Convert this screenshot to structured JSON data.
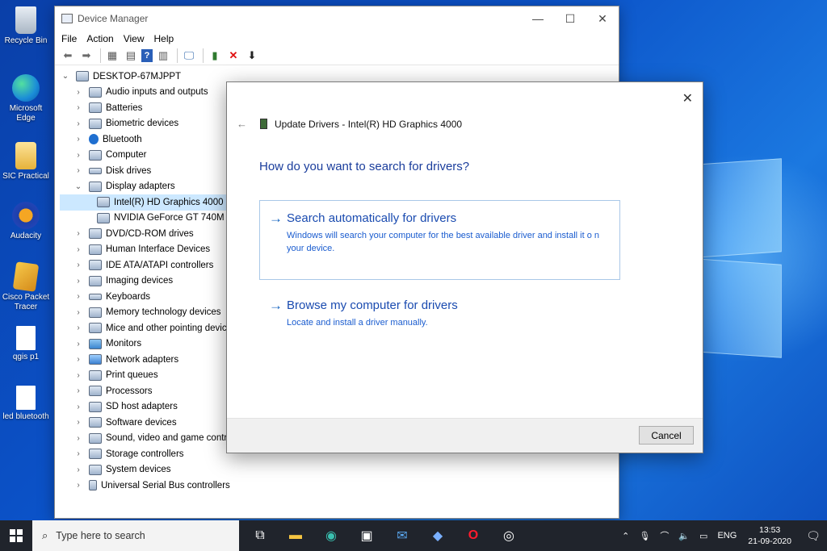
{
  "desktop": {
    "icons": [
      {
        "label": "Recycle Bin",
        "icon": "recycle-bin-icon"
      },
      {
        "label": "Microsoft Edge",
        "icon": "edge-icon"
      },
      {
        "label": "SIC Practical",
        "icon": "folder-icon"
      },
      {
        "label": "Audacity",
        "icon": "audacity-icon"
      },
      {
        "label": "Cisco Packet Tracer",
        "icon": "packet-tracer-icon"
      },
      {
        "label": "qgis p1",
        "icon": "file-icon"
      },
      {
        "label": "led bluetooth",
        "icon": "file-icon"
      }
    ]
  },
  "device_manager": {
    "title": "Device Manager",
    "window_controls": [
      "—",
      "☐",
      "✕"
    ],
    "menu": [
      "File",
      "Action",
      "View",
      "Help"
    ],
    "root": "DESKTOP-67MJPPT",
    "categories": [
      "Audio inputs and outputs",
      "Batteries",
      "Biometric devices",
      "Bluetooth",
      "Computer",
      "Disk drives",
      "Display adapters"
    ],
    "display_children": [
      "Intel(R) HD Graphics 4000",
      "NVIDIA GeForce GT 740M"
    ],
    "categories_after": [
      "DVD/CD-ROM drives",
      "Human Interface Devices",
      "IDE ATA/ATAPI controllers",
      "Imaging devices",
      "Keyboards",
      "Memory technology devices",
      "Mice and other pointing devices",
      "Monitors",
      "Network adapters",
      "Print queues",
      "Processors",
      "SD host adapters",
      "Software devices",
      "Sound, video and game controllers",
      "Storage controllers",
      "System devices",
      "Universal Serial Bus controllers"
    ]
  },
  "dialog": {
    "title": "Update Drivers - Intel(R) HD Graphics 4000",
    "close": "✕",
    "back": "←",
    "question": "How do you want to search for drivers?",
    "option1_title": "Search automatically for drivers",
    "option1_desc": "Windows will search your computer for the best available driver and install it o n your device.",
    "option2_title": "Browse my computer for drivers",
    "option2_desc": "Locate and install a driver manually.",
    "cancel": "Cancel"
  },
  "taskbar": {
    "search_placeholder": "Type here to search",
    "language": "ENG",
    "time": "13:53",
    "date": "21-09-2020"
  }
}
